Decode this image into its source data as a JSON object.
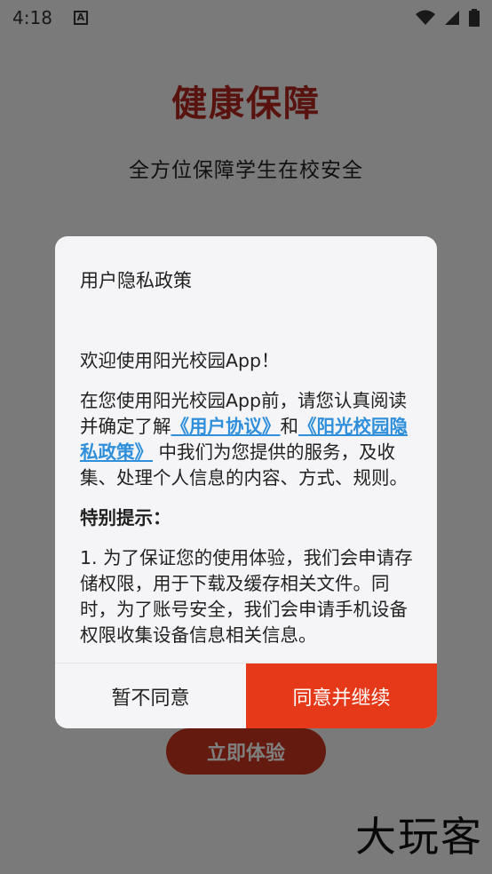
{
  "status_bar": {
    "time": "4:18",
    "notification_glyph": "A"
  },
  "page": {
    "title": "健康保障",
    "subtitle": "全方位保障学生在校安全",
    "try_button": "立即体验",
    "watermark": "大玩客"
  },
  "dialog": {
    "title": "用户隐私政策",
    "welcome": "欢迎使用阳光校园App！",
    "intro_before": "在您使用阳光校园App前，请您认真阅读并确定了解",
    "link_user_agreement": "《用户协议》",
    "and": "和",
    "link_privacy_policy": "《阳光校园隐私政策》",
    "intro_after": " 中我们为您提供的服务，及收集、处理个人信息的内容、方式、规则。",
    "notice_heading": "特别提示：",
    "notice_1": "1. 为了保证您的使用体验，我们会申请存储权限，用于下载及缓存相关文件。同时，为了账号安全，我们会申请手机设备权限收集设备信息相关信息。",
    "disagree_button": "暂不同意",
    "agree_button": "同意并继续"
  },
  "colors": {
    "accent_red": "#e5391a",
    "title_red": "#b3261e",
    "link_blue": "#2f8fdb"
  }
}
